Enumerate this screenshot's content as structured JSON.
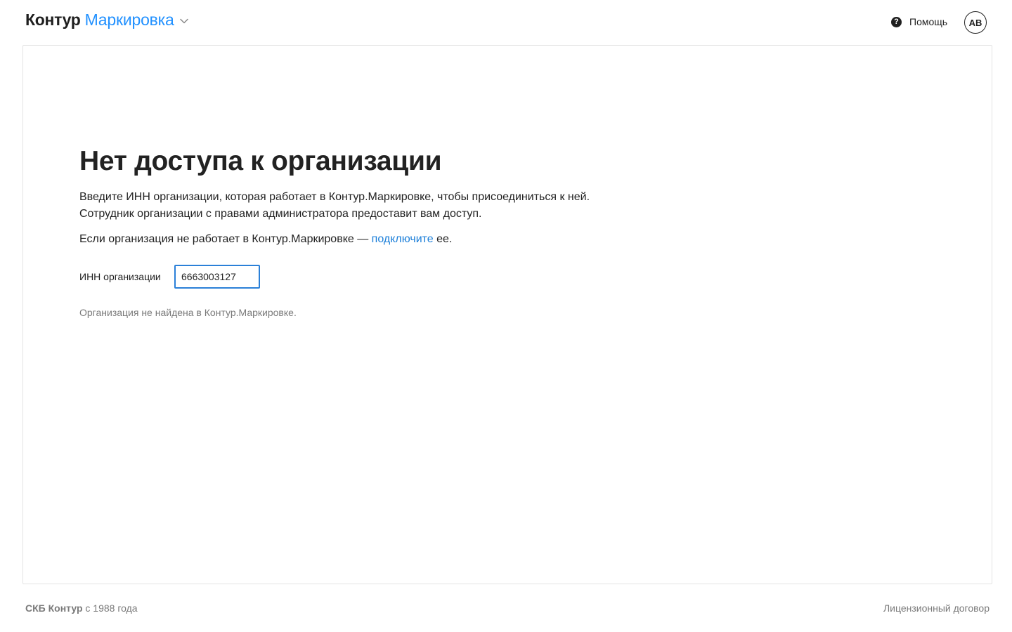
{
  "header": {
    "brand": "Контур",
    "product": "Маркировка",
    "help_label": "Помощь",
    "avatar_initials": "АВ"
  },
  "main": {
    "title": "Нет доступа к организации",
    "intro_line1": "Введите ИНН организации, которая работает в Контур.Маркировке, чтобы присоединиться к ней.",
    "intro_line2": "Сотрудник организации с правами администратора предоставит вам доступ.",
    "connect_prefix": "Если организация не работает в Контур.Маркировке — ",
    "connect_link": "подключите",
    "connect_suffix": " ее.",
    "inn_label": "ИНН организации",
    "inn_value": "6663003127",
    "error_message": "Организация не найдена в Контур.Маркировке."
  },
  "footer": {
    "company": "СКБ Контур",
    "since": " с 1988 года",
    "license_link": "Лицензионный договор"
  },
  "colors": {
    "accent": "#2291ff",
    "link": "#1c7fd9",
    "input_focus_border": "#2b80d8",
    "muted_text": "#7a7a7a"
  },
  "icons": {
    "dropdown": "chevron-down-icon",
    "help": "question-circle-icon"
  }
}
